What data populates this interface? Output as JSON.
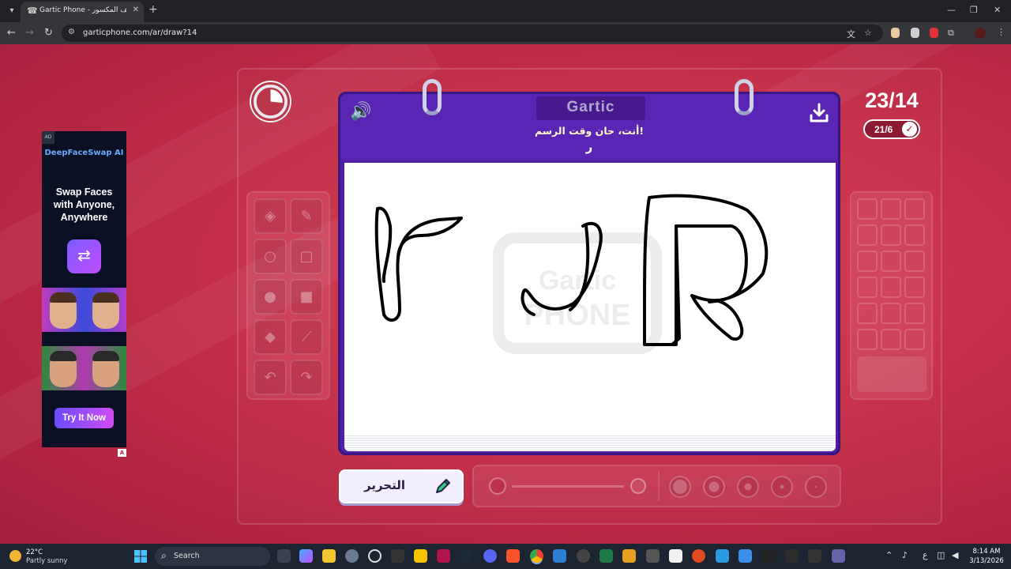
{
  "browser": {
    "tab_title": "Gartic Phone - الهاتف المكسور",
    "url": "garticphone.com/ar/draw?14",
    "tab_close": "✕",
    "new_tab": "+",
    "minimize": "—",
    "restore": "❐",
    "close": "✕",
    "back": "←",
    "forward": "→",
    "reload": "↻"
  },
  "ad": {
    "tag": "AD",
    "brand": "DeepFaceSwap AI",
    "headline": "Swap Faces with Anyone, Anywhere",
    "cta": "Try It Now",
    "choices_badge": "A"
  },
  "game": {
    "counter": "23/14",
    "players_done": "21/6",
    "logo": "Gartic",
    "prompt": "أنت، حان وقت الرسم!",
    "word": "ر",
    "edit_label": "التحرير",
    "tools": [
      "eraser-icon",
      "pencil-icon",
      "ellipse-outline-icon",
      "rectangle-outline-icon",
      "ellipse-filled-icon",
      "rectangle-filled-icon",
      "fill-bucket-icon",
      "line-icon",
      "undo-icon",
      "redo-icon"
    ],
    "palette_rows": 6,
    "palette_cols": 3
  },
  "taskbar": {
    "temp": "22°C",
    "weather": "Partly sunny",
    "search": "Search",
    "time": "8:14 AM",
    "date": "3/13/2026",
    "lang": "ع"
  },
  "colors": {
    "page_bg": "#c52f48",
    "board": "#5a25b5",
    "prompt": "#fff9c8",
    "accent_pill": "#8c1a33"
  }
}
